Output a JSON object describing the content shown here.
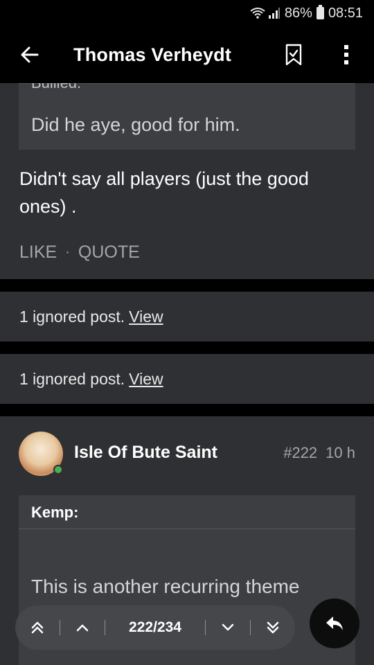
{
  "status_bar": {
    "battery": "86%",
    "time": "08:51"
  },
  "app_bar": {
    "title": "Thomas Verheydt"
  },
  "post_a": {
    "quote_top_sliver": "Bullied.",
    "quote_text": "Did he aye, good for him.",
    "body": "Didn't say all players (just the good ones) .",
    "like_label": "LIKE",
    "separator": "·",
    "quote_label": "QUOTE"
  },
  "ignored": [
    {
      "text": "1 ignored post.",
      "link": "View"
    },
    {
      "text": "1 ignored post.",
      "link": "View"
    }
  ],
  "post_b": {
    "author": "Isle Of Bute Saint",
    "number": "#222",
    "time": "10 h",
    "quote_head": "Kemp:",
    "quote_text": "This is another recurring theme"
  },
  "pager": {
    "page": "222/234"
  },
  "icons": {
    "back": "arrow-left-icon",
    "bookmark": "bookmark-icon",
    "more": "more-vert-icon",
    "first": "double-chevron-up-icon",
    "prev": "chevron-up-icon",
    "next": "chevron-down-icon",
    "last": "double-chevron-down-icon",
    "reply": "reply-icon"
  },
  "colors": {
    "background": "#000000",
    "card": "#2f3033",
    "quote": "#3c3e42",
    "online": "#4caf50"
  }
}
